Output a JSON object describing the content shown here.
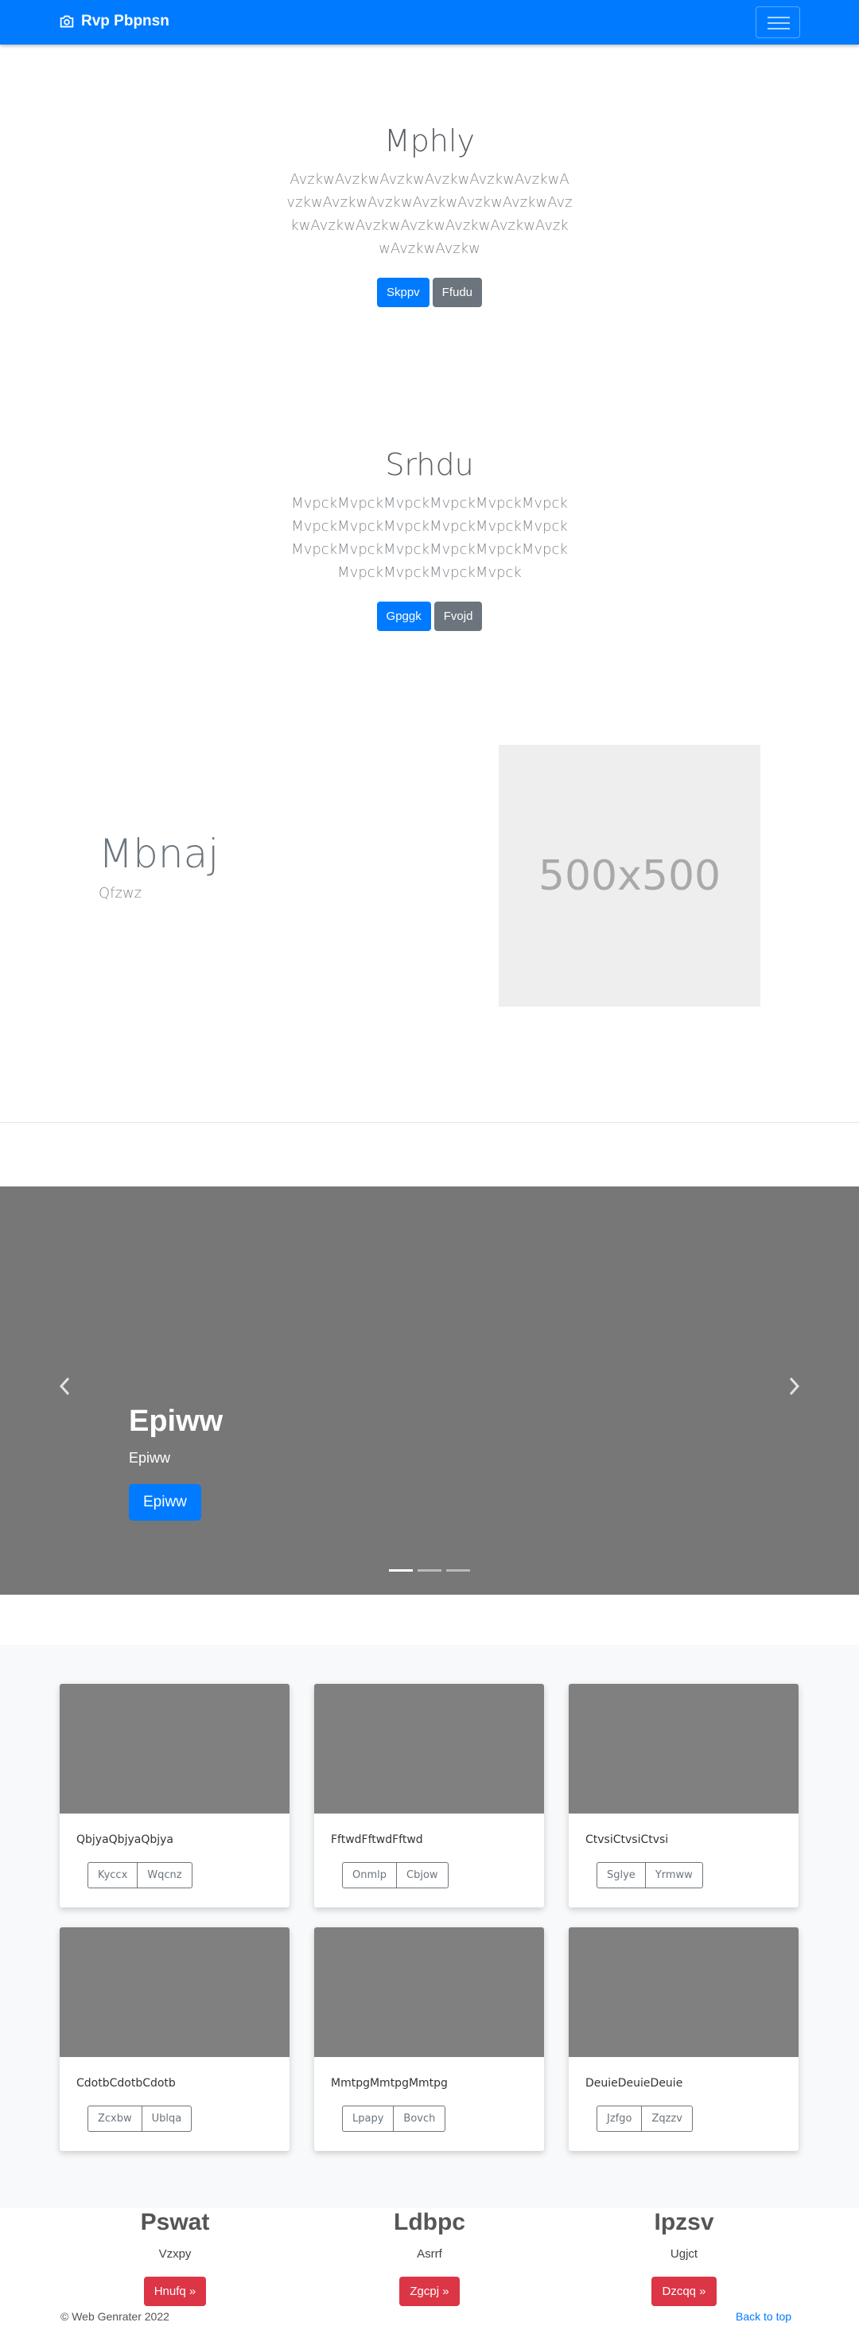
{
  "navbar": {
    "brand": "Rvp Pbpnsn",
    "brand_icon": "camera-icon",
    "toggle_icon": "hamburger-icon"
  },
  "hero1": {
    "title": "Mphly",
    "lead": "AvzkwAvzkwAvzkwAvzkwAvzkwAvzkwAvzkwAvzkwAvzkwAvzkwAvzkwAvzkwAvzkwAvzkwAvzkwAvzkwAvzkwAvzkwAvzkwAvzkwAvzkw",
    "btn_primary": "Skppv",
    "btn_secondary": "Ffudu"
  },
  "hero2": {
    "title": "Srhdu",
    "lead": "MvpckMvpckMvpckMvpckMvpckMvpckMvpckMvpckMvpckMvpckMvpckMvpckMvpckMvpckMvpckMvpckMvpckMvpckMvpckMvpckMvpckMvpck",
    "btn_primary": "Gpggk",
    "btn_secondary": "Fvojd"
  },
  "feature": {
    "title": "Mbnaj",
    "subtitle": "Qfzwz",
    "placeholder": "500x500"
  },
  "carousel": {
    "title": "Epiww",
    "text": "Epiww",
    "button": "Epiww",
    "prev_icon": "chevron-left-icon",
    "next_icon": "chevron-right-icon",
    "slides": 3,
    "active": 0
  },
  "cards": [
    {
      "text": "QbjyaQbjyaQbjya",
      "btn1": "Kyccx",
      "btn2": "Wqcnz"
    },
    {
      "text": "FftwdFftwdFftwd",
      "btn1": "Onmlp",
      "btn2": "Cbjow"
    },
    {
      "text": "CtvsiCtvsiCtvsi",
      "btn1": "Sglye",
      "btn2": "Yrmww"
    },
    {
      "text": "CdotbCdotbCdotb",
      "btn1": "Zcxbw",
      "btn2": "Ublqa"
    },
    {
      "text": "MmtpgMmtpgMmtpg",
      "btn1": "Lpapy",
      "btn2": "Bovch"
    },
    {
      "text": "DeuieDeuieDeuie",
      "btn1": "Jzfgo",
      "btn2": "Zqzzv"
    }
  ],
  "columns": [
    {
      "title": "Pswat",
      "text": "Vzxpy",
      "button": "Hnufq »"
    },
    {
      "title": "Ldbpc",
      "text": "Asrrf",
      "button": "Zgcpj »"
    },
    {
      "title": "Ipzsv",
      "text": "Ugjct",
      "button": "Dzcqq »"
    }
  ],
  "footer": {
    "copyright": "© Web Genrater 2022",
    "back_to_top": "Back to top"
  }
}
